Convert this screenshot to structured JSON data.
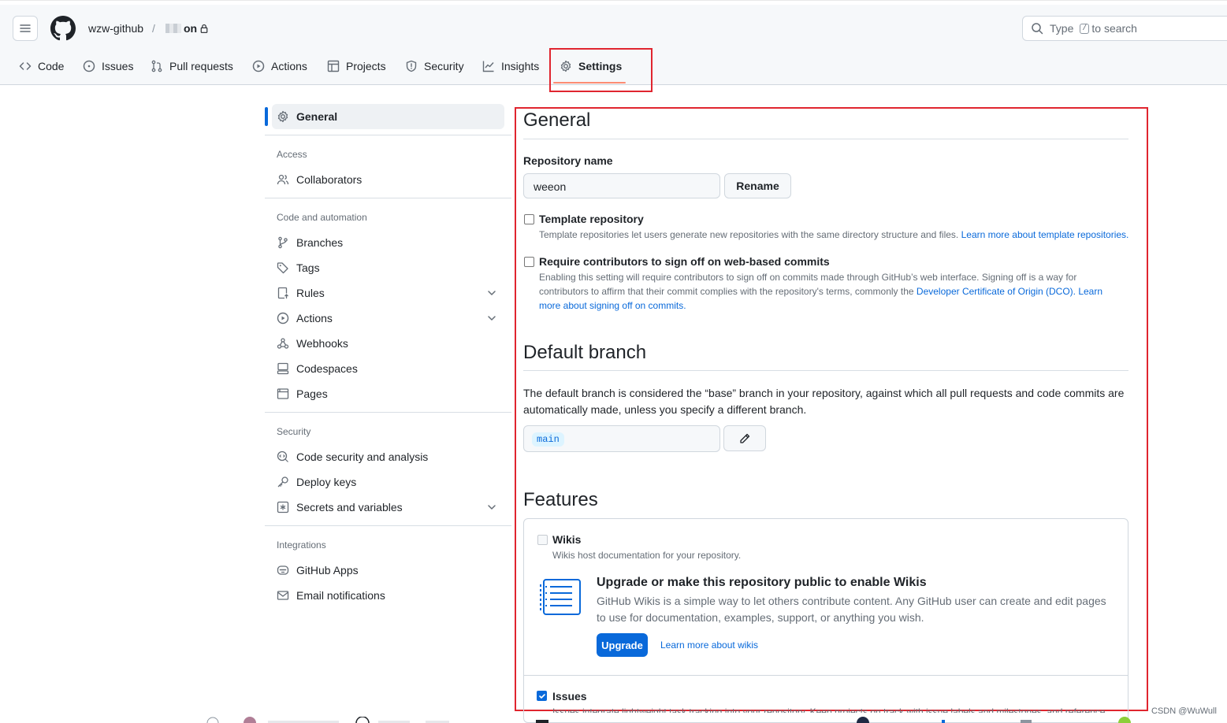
{
  "header": {
    "owner": "wzw-github",
    "separator": "/",
    "repo_suffix": "on",
    "search_pre": "Type",
    "search_key": "/",
    "search_post": "to search"
  },
  "tabs": [
    {
      "label": "Code",
      "icon": "code-icon"
    },
    {
      "label": "Issues",
      "icon": "issue-opened-icon"
    },
    {
      "label": "Pull requests",
      "icon": "git-pull-request-icon"
    },
    {
      "label": "Actions",
      "icon": "play-icon"
    },
    {
      "label": "Projects",
      "icon": "table-icon"
    },
    {
      "label": "Security",
      "icon": "shield-icon"
    },
    {
      "label": "Insights",
      "icon": "graph-icon"
    },
    {
      "label": "Settings",
      "icon": "gear-icon",
      "selected": true
    }
  ],
  "sidebar": {
    "general": "General",
    "access_head": "Access",
    "collaborators": "Collaborators",
    "code_head": "Code and automation",
    "branches": "Branches",
    "tags": "Tags",
    "rules": "Rules",
    "actions": "Actions",
    "webhooks": "Webhooks",
    "codespaces": "Codespaces",
    "pages": "Pages",
    "security_head": "Security",
    "code_security": "Code security and analysis",
    "deploy_keys": "Deploy keys",
    "secrets": "Secrets and variables",
    "integrations_head": "Integrations",
    "github_apps": "GitHub Apps",
    "email_notifications": "Email notifications"
  },
  "general": {
    "title": "General",
    "repo_name_label": "Repository name",
    "repo_name_value": "weeon",
    "rename_button": "Rename",
    "template_title": "Template repository",
    "template_desc": "Template repositories let users generate new repositories with the same directory structure and files.",
    "template_link": "Learn more about template repositories.",
    "signoff_title": "Require contributors to sign off on web-based commits",
    "signoff_desc_1": "Enabling this setting will require contributors to sign off on commits made through GitHub’s web interface. Signing off is a way for",
    "signoff_desc_2": "contributors to affirm that their commit complies with the repository's terms, commonly the",
    "signoff_link_1": "Developer Certificate of Origin (DCO).",
    "signoff_link_2a": "Learn",
    "signoff_link_2b": "more about signing off on commits."
  },
  "default_branch": {
    "title": "Default branch",
    "desc_1": "The default branch is considered the “base” branch in your repository, against which all pull requests and code commits are",
    "desc_2": "automatically made, unless you specify a different branch.",
    "branch": "main"
  },
  "features": {
    "title": "Features",
    "wikis_title": "Wikis",
    "wikis_desc": "Wikis host documentation for your repository.",
    "wikis_checked": false,
    "upgrade_title": "Upgrade or make this repository public to enable Wikis",
    "upgrade_desc_1": "GitHub Wikis is a simple way to let others contribute content. Any GitHub user can create and edit pages",
    "upgrade_desc_2": "to use for documentation, examples, support, or anything you wish.",
    "upgrade_button": "Upgrade",
    "wikis_link": "Learn more about wikis",
    "issues_title": "Issues",
    "issues_checked": true,
    "issues_desc": "Issues integrate lightweight task tracking into your repository. Keep projects on track with issue labels and milestones, and reference"
  },
  "watermark": "CSDN @WuWull",
  "colors": {
    "accent": "#0969da",
    "highlight_box": "#e0252f",
    "tab_underline": "#fd8c73"
  }
}
